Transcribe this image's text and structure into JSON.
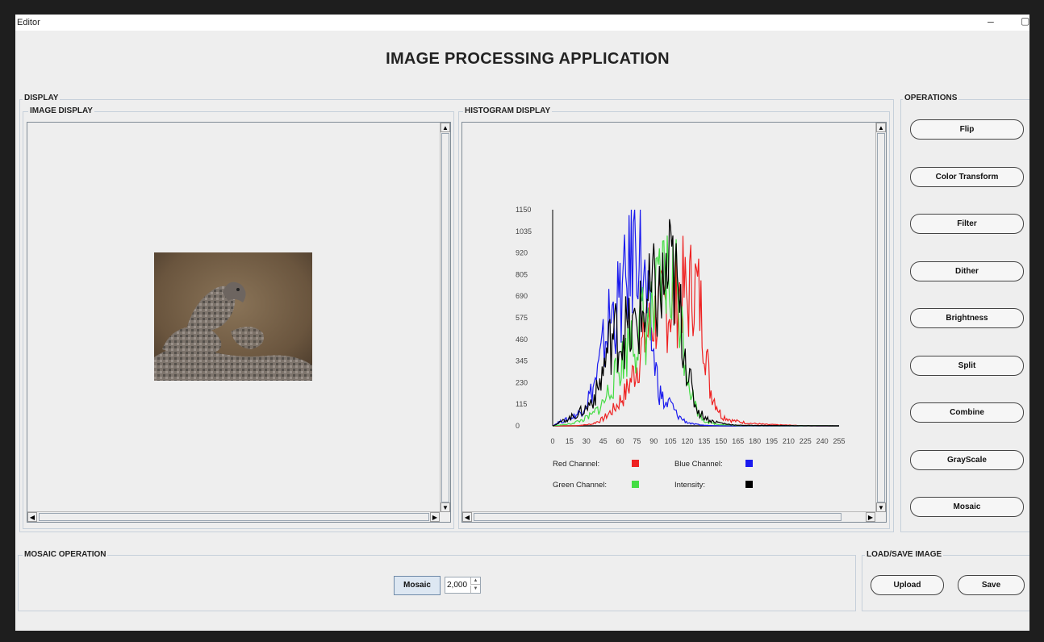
{
  "window": {
    "title": "Editor",
    "minimize_glyph": "–",
    "restore_glyph": "▢"
  },
  "app_title": "IMAGE PROCESSING APPLICATION",
  "display": {
    "label": "DISPLAY",
    "image_display": {
      "label": "IMAGE DISPLAY"
    },
    "histogram_display": {
      "label": "HISTOGRAM DISPLAY"
    }
  },
  "operations": {
    "label": "OPERATIONS",
    "buttons": [
      "Flip",
      "Color Transform",
      "Filter",
      "Dither",
      "Brightness",
      "Split",
      "Combine",
      "GrayScale",
      "Mosaic"
    ]
  },
  "mosaic_operation": {
    "label": "MOSAIC OPERATION",
    "button_label": "Mosaic",
    "value": "2,000"
  },
  "load_save": {
    "label": "LOAD/SAVE IMAGE",
    "upload_label": "Upload",
    "save_label": "Save"
  },
  "chart_data": {
    "type": "line",
    "title": "",
    "xlabel": "",
    "ylabel": "",
    "x_ticks": [
      0,
      15,
      30,
      45,
      60,
      75,
      90,
      105,
      120,
      135,
      150,
      165,
      180,
      195,
      210,
      225,
      240,
      255
    ],
    "y_ticks": [
      0,
      115,
      230,
      345,
      460,
      575,
      690,
      805,
      920,
      1035,
      1150
    ],
    "xlim": [
      0,
      255
    ],
    "ylim": [
      0,
      1150
    ],
    "legend_placement": "bottom",
    "legend": [
      {
        "name": "Red Channel:",
        "color": "#ee2222"
      },
      {
        "name": "Blue Channel:",
        "color": "#1a1aee"
      },
      {
        "name": "Green Channel:",
        "color": "#44dd44"
      },
      {
        "name": "Intensity:",
        "color": "#000000"
      }
    ],
    "series": [
      {
        "name": "Red Channel:",
        "color": "#ee2222",
        "x": [
          0,
          20,
          35,
          45,
          55,
          65,
          75,
          80,
          90,
          100,
          110,
          115,
          120,
          125,
          130,
          135,
          140,
          150,
          160,
          175,
          190,
          205,
          215,
          225,
          255
        ],
        "y": [
          0,
          0,
          10,
          40,
          100,
          190,
          350,
          460,
          620,
          670,
          730,
          800,
          710,
          840,
          740,
          540,
          220,
          60,
          30,
          15,
          8,
          5,
          3,
          0,
          0
        ]
      },
      {
        "name": "Blue Channel:",
        "color": "#1a1aee",
        "x": [
          0,
          5,
          15,
          25,
          35,
          40,
          45,
          50,
          55,
          60,
          65,
          70,
          75,
          78,
          80,
          85,
          90,
          95,
          100,
          105,
          110,
          115,
          120,
          125,
          135,
          150,
          255
        ],
        "y": [
          0,
          20,
          40,
          80,
          200,
          300,
          450,
          600,
          660,
          720,
          800,
          950,
          1150,
          1020,
          880,
          640,
          400,
          200,
          120,
          130,
          70,
          40,
          20,
          10,
          3,
          0,
          0
        ]
      },
      {
        "name": "Green Channel:",
        "color": "#44dd44",
        "x": [
          0,
          15,
          25,
          35,
          45,
          50,
          55,
          60,
          65,
          70,
          75,
          80,
          85,
          90,
          95,
          100,
          105,
          108,
          112,
          115,
          120,
          125,
          130,
          135,
          145,
          165,
          255
        ],
        "y": [
          0,
          10,
          30,
          60,
          130,
          200,
          270,
          340,
          420,
          550,
          480,
          600,
          560,
          640,
          760,
          870,
          800,
          860,
          780,
          560,
          320,
          160,
          70,
          30,
          10,
          2,
          0
        ]
      },
      {
        "name": "Intensity:",
        "color": "#000000",
        "x": [
          0,
          10,
          20,
          30,
          40,
          45,
          50,
          55,
          60,
          65,
          70,
          75,
          80,
          85,
          90,
          95,
          100,
          105,
          110,
          115,
          120,
          125,
          130,
          140,
          155,
          165,
          255
        ],
        "y": [
          0,
          30,
          60,
          100,
          200,
          320,
          460,
          540,
          500,
          560,
          520,
          580,
          640,
          700,
          760,
          720,
          820,
          900,
          800,
          560,
          340,
          160,
          80,
          30,
          10,
          3,
          0
        ]
      }
    ]
  }
}
